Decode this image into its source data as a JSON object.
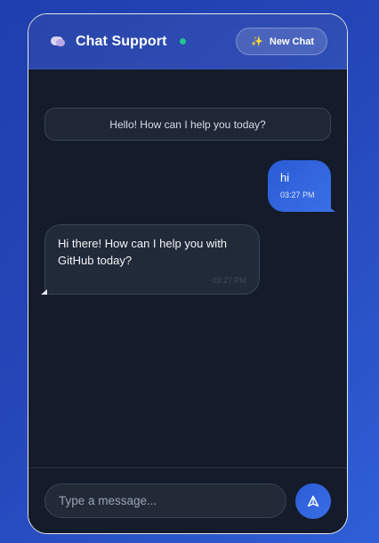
{
  "header": {
    "icon": "chat-bubbles-icon",
    "title": "Chat Support",
    "status_color": "#22c58b",
    "new_chat_icon": "sparkle-icon",
    "new_chat_label": "New Chat"
  },
  "messages": {
    "system_message": "Hello! How can I help you today?",
    "user_message": {
      "text": "hi",
      "time": "03:27 PM"
    },
    "bot_message": {
      "text": "Hi there! How can I help you with GitHub today?",
      "time": "03:27 PM"
    }
  },
  "composer": {
    "placeholder": "Type a message...",
    "send_icon": "send-icon"
  },
  "colors": {
    "accent": "#2f5fd6",
    "panel": "#141b2a",
    "bubble": "#212a39"
  }
}
